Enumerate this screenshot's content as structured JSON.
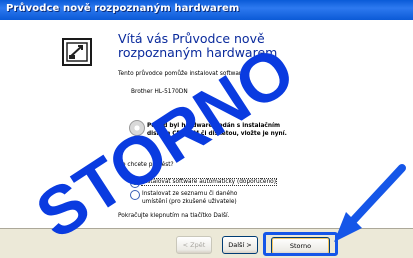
{
  "window": {
    "title": "Průvodce nově rozpoznaným hardwarem"
  },
  "main": {
    "heading": "Vítá vás Průvodce nově rozpoznaným hardwarem",
    "intro_text": "Tento průvodce pomůže instalovat software",
    "device_name": "Brother HL-5170DN",
    "cd_text_line1": "Pokud byl hardware dodán s instalačním",
    "cd_text_line2": "diskem CD-ROM či disketou, vložte je nyní.",
    "question": "Co chcete provést?",
    "option_auto": "Instalovat software automaticky (doporučeno)",
    "option_manual_line1": "Instalovat ze seznamu či daného",
    "option_manual_line2": "umístění (pro zkušené uživatele)",
    "continue_hint": "Pokračujte klepnutím na tlačítko Další."
  },
  "footer": {
    "back_label": "< Zpět",
    "next_label": "Další >",
    "cancel_label": "Storno"
  },
  "overlay": {
    "stamp_text": "STORNO",
    "stamp_color": "#0a3be0",
    "arrow_color": "#1556e8"
  },
  "icons": {
    "cd": "cd-icon",
    "hardware": "hardware-icon",
    "arrow": "arrow-icon"
  }
}
